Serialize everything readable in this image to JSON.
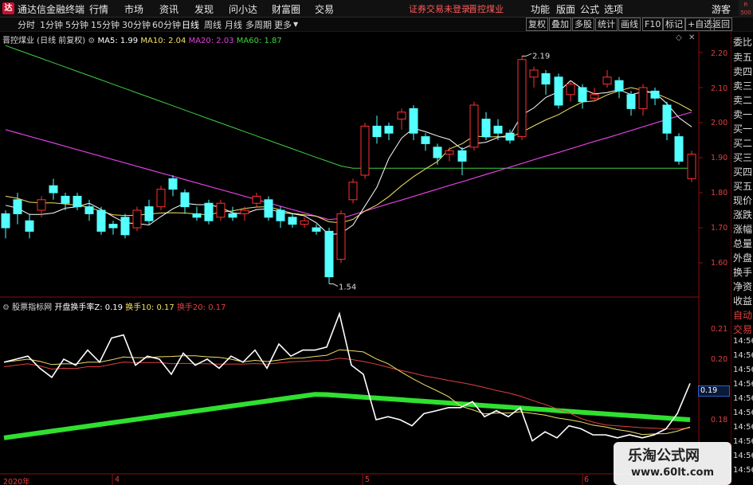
{
  "titlebar": {
    "app_title": "通达信金融终端",
    "menus": [
      "行情",
      "市场",
      "资讯",
      "发现",
      "问小达",
      "财富圈",
      "交易"
    ],
    "login_status": "证券交易未登录",
    "stock_name": "晋控煤业",
    "right_menus": [
      "功能",
      "版面",
      "公式",
      "选项"
    ],
    "guest": "游客",
    "badge": "R 500"
  },
  "toolbar": {
    "periods": [
      "分时",
      "1分钟",
      "5分钟",
      "15分钟",
      "30分钟",
      "60分钟",
      "日线",
      "周线",
      "月线",
      "多周期",
      "更多"
    ],
    "active_period": "日线",
    "right_buttons": [
      "复权",
      "叠加",
      "多股",
      "统计",
      "画线",
      "F10",
      "标记",
      "+自选",
      "返回"
    ]
  },
  "main_panel": {
    "stock_label": "晋控煤业 (日线 前复权)",
    "ma": [
      {
        "label": "MA5: 1.99",
        "color": "#ffffff"
      },
      {
        "label": "MA10: 2.04",
        "color": "#f0e060"
      },
      {
        "label": "MA20: 2.03",
        "color": "#e040e0"
      },
      {
        "label": "MA60: 1.87",
        "color": "#40d040"
      }
    ],
    "high_annotation": "2.19",
    "low_annotation": "1.54",
    "y_ticks": [
      "2.20",
      "2.10",
      "2.00",
      "1.90",
      "1.80",
      "1.70",
      "1.60"
    ]
  },
  "sub_panel": {
    "indicator_name": "股票指标网",
    "indicator_title": "开盘换手率Z: 0.19",
    "line2": "换手10: 0.17",
    "line3": "换手20: 0.17",
    "line2_color": "#f0e060",
    "line3_color": "#e04040",
    "y_ticks": [
      "0.21",
      "0.20",
      "0.19",
      "0.18"
    ],
    "current_value": "0.19",
    "x_ticks": [
      "2020年",
      "4",
      "5",
      "6"
    ]
  },
  "side_panel": {
    "items": [
      "委比",
      "卖五",
      "卖四",
      "卖三",
      "卖二",
      "卖一",
      "买一",
      "买二",
      "买三",
      "买四",
      "买五",
      "现价",
      "涨跌",
      "涨幅",
      "总量",
      "外盘",
      "换手",
      "净资",
      "收益",
      "自动",
      "交易",
      "14:56",
      "14:56",
      "14:56",
      "14:56",
      "14:56",
      "14:56",
      "14:56",
      "14:56",
      "14:56",
      "14:56"
    ]
  },
  "watermark": {
    "line1": "乐淘公式网",
    "line2": "www.60lt.com"
  },
  "colors": {
    "up": "#ff3030",
    "down": "#54ffff",
    "ma5": "#ffffff",
    "ma10": "#f0e060",
    "ma20": "#e040e0",
    "ma60": "#40d040"
  }
}
